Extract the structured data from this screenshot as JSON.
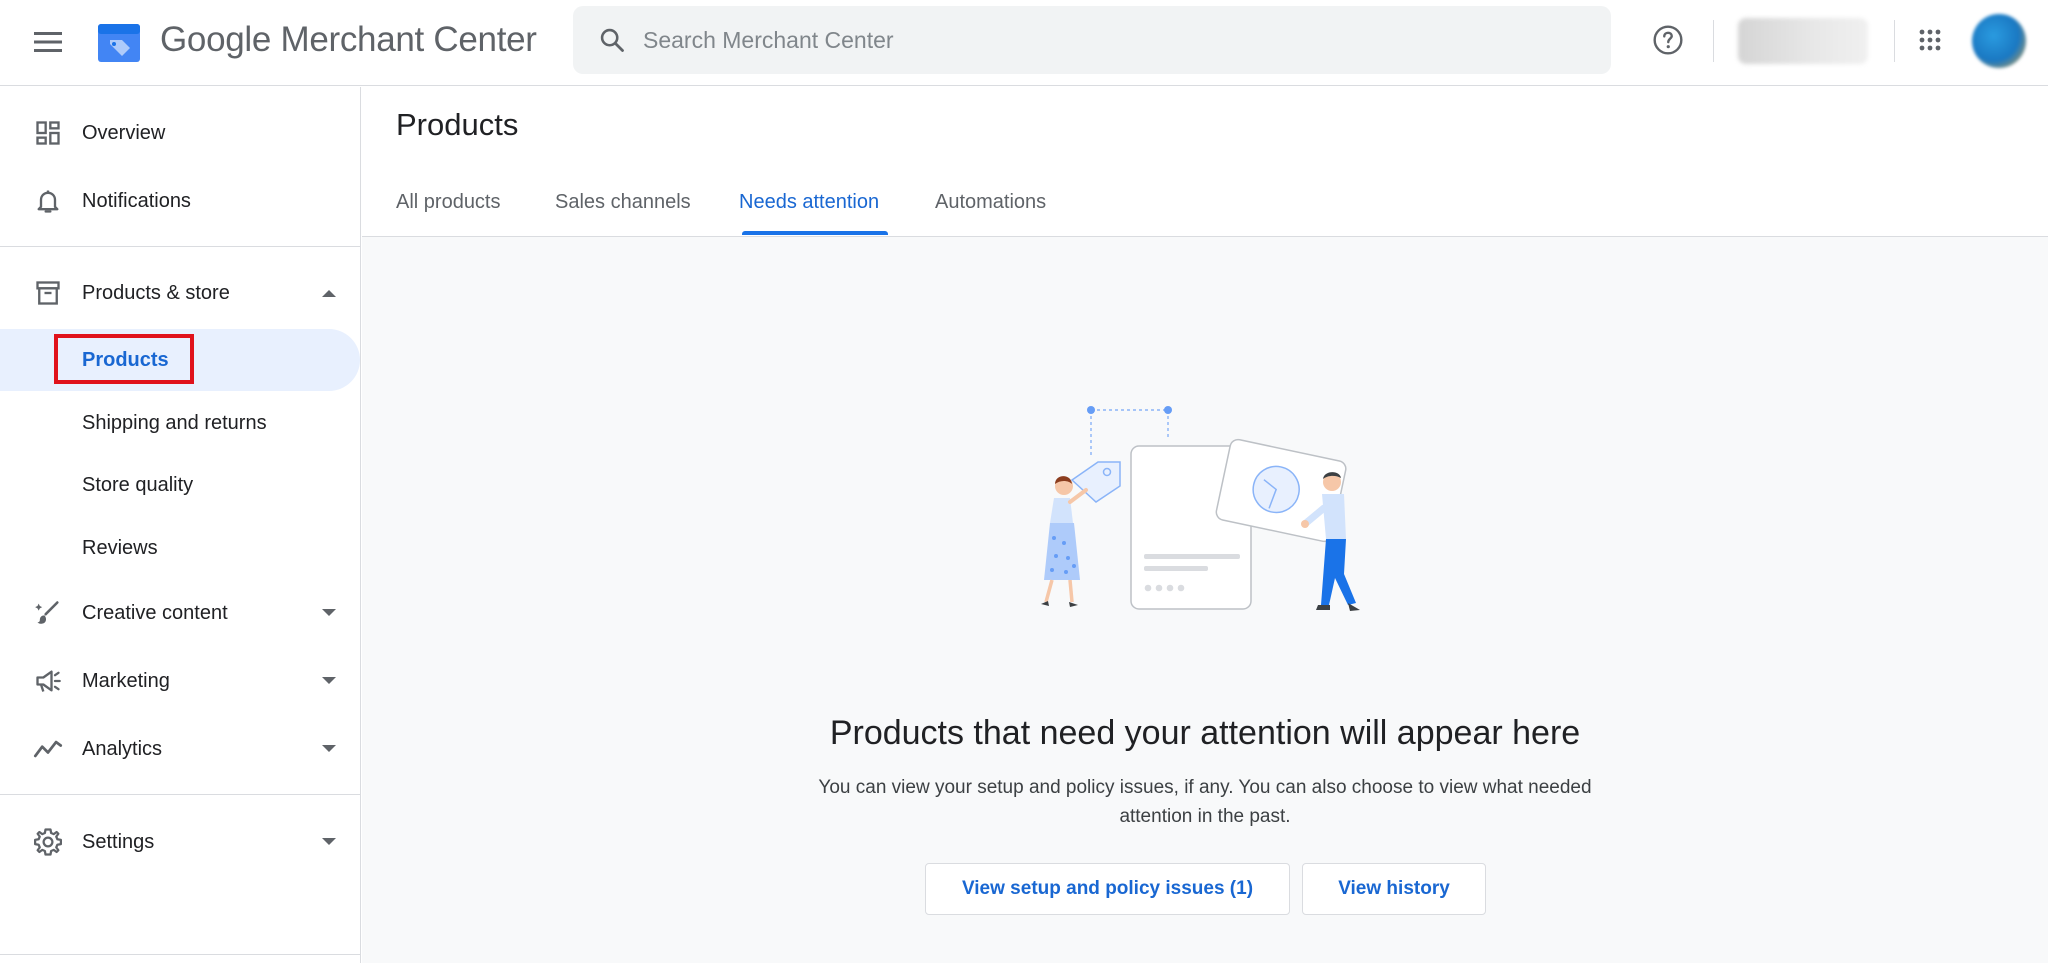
{
  "header": {
    "brand": "Google Merchant Center",
    "search_placeholder": "Search Merchant Center"
  },
  "sidebar": {
    "items": [
      {
        "label": "Overview",
        "icon": "dashboard-icon"
      },
      {
        "label": "Notifications",
        "icon": "bell-icon"
      },
      {
        "label": "Products & store",
        "icon": "store-icon",
        "expanded": true
      },
      {
        "label": "Products",
        "active": true
      },
      {
        "label": "Shipping and returns"
      },
      {
        "label": "Store quality"
      },
      {
        "label": "Reviews"
      },
      {
        "label": "Creative content",
        "icon": "brush-icon"
      },
      {
        "label": "Marketing",
        "icon": "megaphone-icon"
      },
      {
        "label": "Analytics",
        "icon": "trending-icon"
      },
      {
        "label": "Settings",
        "icon": "gear-icon"
      }
    ]
  },
  "main": {
    "title": "Products",
    "tabs": [
      {
        "label": "All products"
      },
      {
        "label": "Sales channels"
      },
      {
        "label": "Needs attention",
        "active": true
      },
      {
        "label": "Automations"
      }
    ],
    "empty_state": {
      "title": "Products that need your attention will appear here",
      "description": "You can view your setup and policy issues, if any. You can also choose to view what needed attention in the past.",
      "primary_button": "View setup and policy issues (1)",
      "secondary_button": "View history"
    }
  },
  "colors": {
    "accent": "#1967d2",
    "active_bg": "#e8f0fe",
    "highlight": "#e0121b"
  }
}
